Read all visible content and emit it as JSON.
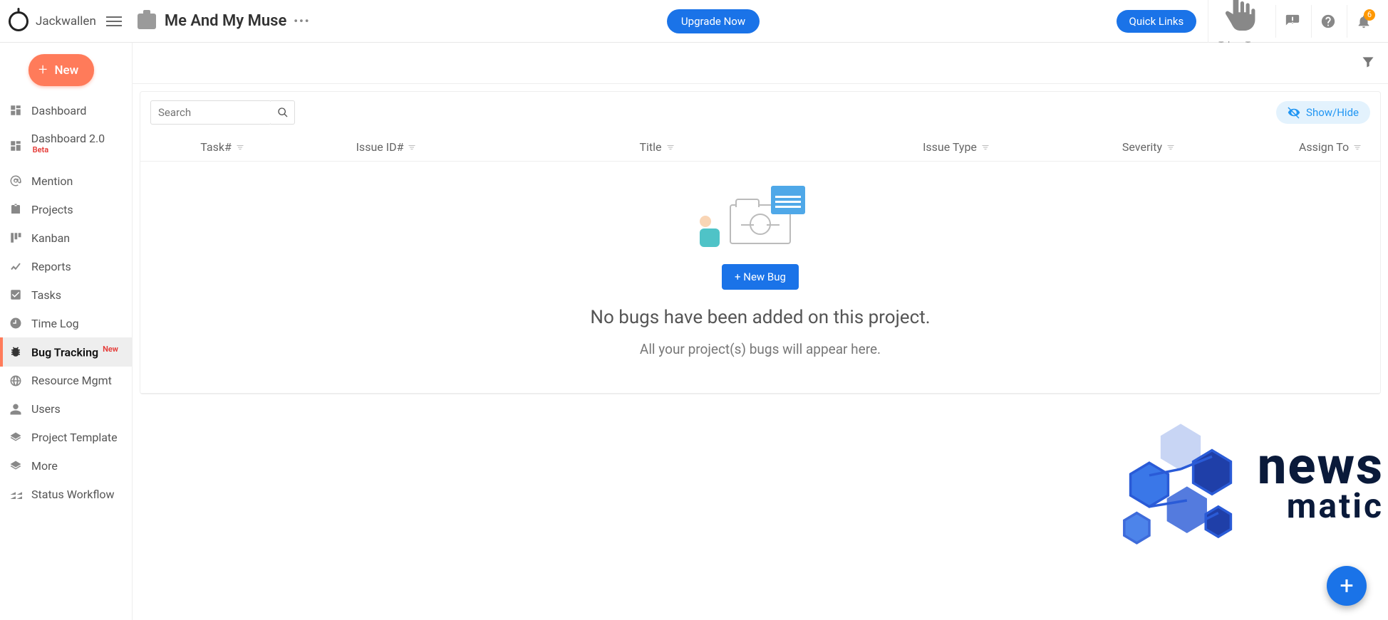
{
  "header": {
    "username": "Jackwallen",
    "project_title": "Me And My Muse",
    "upgrade_label": "Upgrade Now",
    "quick_links_label": "Quick Links",
    "tour_label": "Take a Tour",
    "notification_count": "6"
  },
  "sidebar": {
    "new_label": "New",
    "items": [
      {
        "label": "Dashboard"
      },
      {
        "label": "Dashboard 2.0",
        "tag": "Beta"
      },
      {
        "label": "Mention"
      },
      {
        "label": "Projects"
      },
      {
        "label": "Kanban"
      },
      {
        "label": "Reports"
      },
      {
        "label": "Tasks"
      },
      {
        "label": "Time Log"
      },
      {
        "label": "Bug Tracking",
        "tag": "New",
        "active": true
      },
      {
        "label": "Resource Mgmt"
      },
      {
        "label": "Users"
      },
      {
        "label": "Project Template"
      },
      {
        "label": "More"
      },
      {
        "label": "Status Workflow"
      }
    ]
  },
  "main": {
    "search_placeholder": "Search",
    "showhide_label": "Show/Hide",
    "columns": [
      "Task#",
      "Issue ID#",
      "Title",
      "Issue Type",
      "Severity",
      "Assign To"
    ],
    "new_bug_label": "+ New Bug",
    "empty_title": "No bugs have been added on this project.",
    "empty_sub": "All your project(s) bugs will appear here."
  },
  "watermark": {
    "line1": "news",
    "line2": "matic"
  }
}
